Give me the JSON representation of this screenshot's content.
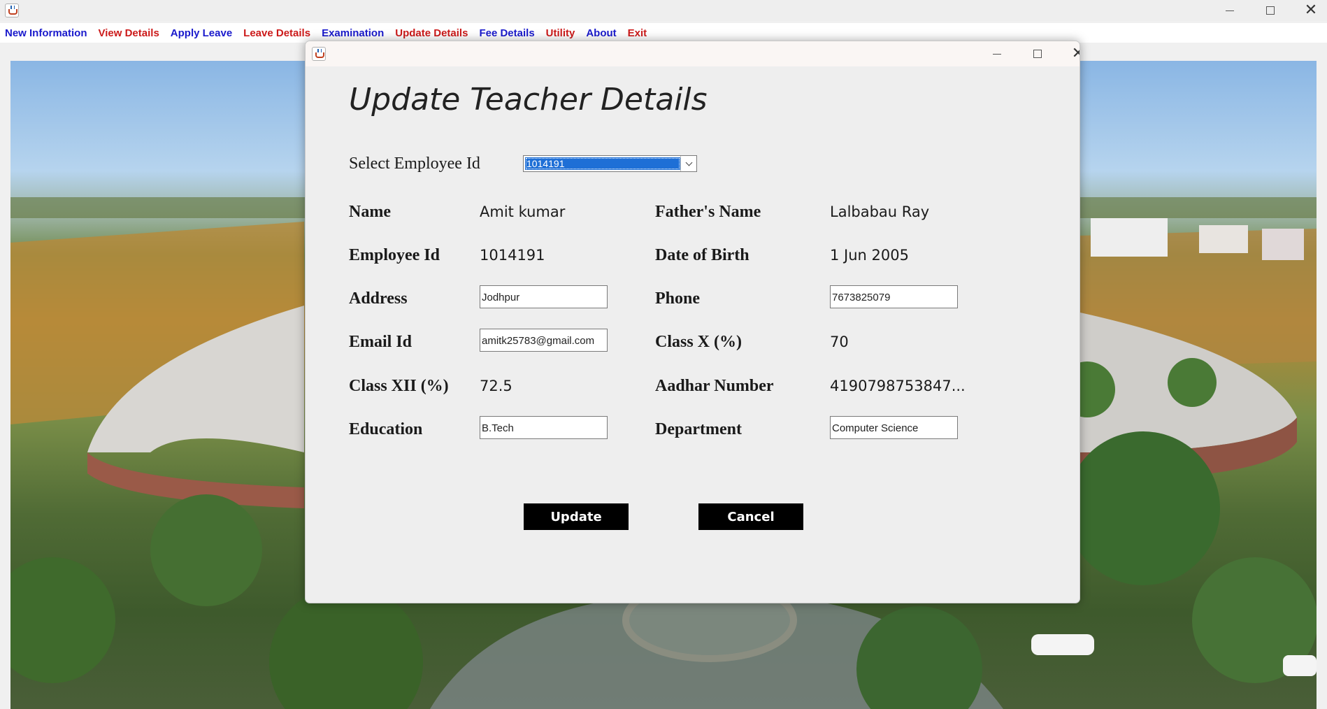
{
  "menu": {
    "items": [
      {
        "label": "New Information",
        "color": "#1a1acc"
      },
      {
        "label": "View Details",
        "color": "#cc1a1a"
      },
      {
        "label": "Apply Leave",
        "color": "#1a1acc"
      },
      {
        "label": "Leave Details",
        "color": "#cc1a1a"
      },
      {
        "label": "Examination",
        "color": "#1a1acc"
      },
      {
        "label": "Update Details",
        "color": "#cc1a1a"
      },
      {
        "label": "Fee Details",
        "color": "#1a1acc"
      },
      {
        "label": "Utility",
        "color": "#cc1a1a"
      },
      {
        "label": "About",
        "color": "#1a1acc"
      },
      {
        "label": "Exit",
        "color": "#cc1a1a"
      }
    ]
  },
  "dialog": {
    "title": "Update Teacher Details",
    "select_label": "Select Employee Id",
    "selected_employee_id": "1014191",
    "fields": {
      "name_label": "Name",
      "name_value": "Amit kumar",
      "father_label": "Father's Name",
      "father_value": "Lalbabau Ray",
      "empid_label": "Employee Id",
      "empid_value": "1014191",
      "dob_label": "Date of Birth",
      "dob_value": "1 Jun 2005",
      "address_label": "Address",
      "address_value": "Jodhpur",
      "phone_label": "Phone",
      "phone_value": "7673825079",
      "email_label": "Email Id",
      "email_value": "amitk25783@gmail.com",
      "classx_label": "Class X (%)",
      "classx_value": "70",
      "classxii_label": "Class XII (%)",
      "classxii_value": "72.5",
      "aadhar_label": "Aadhar Number",
      "aadhar_value": "4190798753847...",
      "education_label": "Education",
      "education_value": "B.Tech",
      "department_label": "Department",
      "department_value": "Computer Science"
    },
    "update_label": "Update",
    "cancel_label": "Cancel"
  },
  "window_controls": {
    "minimize_icon": "minimize-icon",
    "maximize_icon": "maximize-icon",
    "close_icon": "close-icon"
  }
}
